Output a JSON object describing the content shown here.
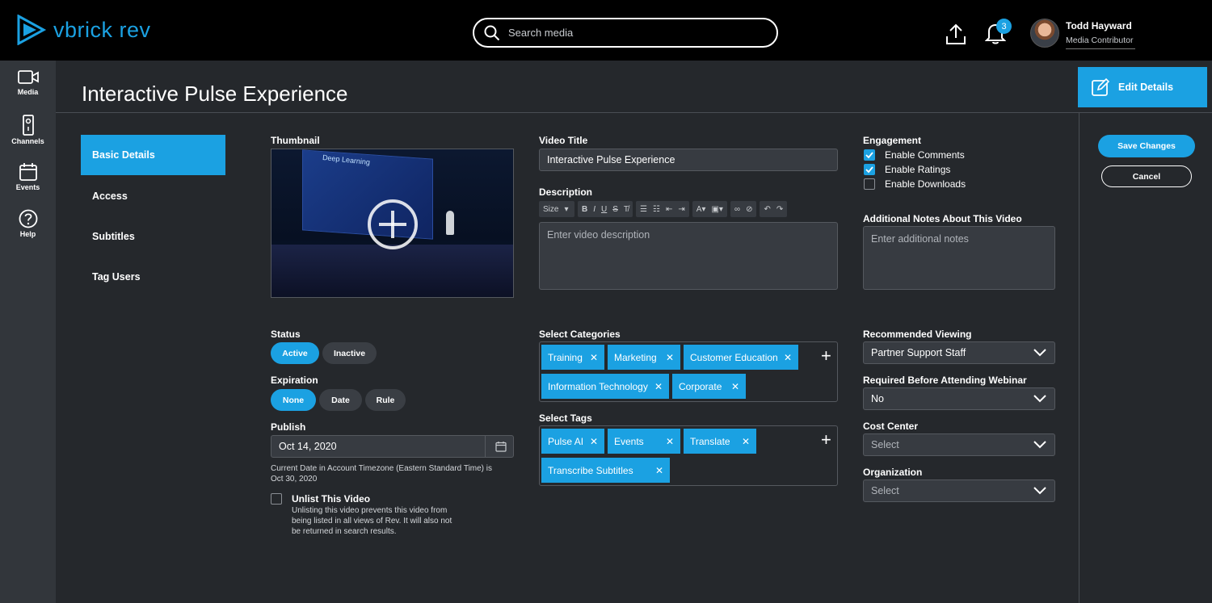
{
  "brand": {
    "name": "vbrick rev",
    "accent": "#1ba1e2"
  },
  "search": {
    "placeholder": "Search media",
    "icon": "search-icon"
  },
  "header": {
    "notification_count": "3",
    "user_name": "Todd Hayward",
    "user_role": "Media Contributor"
  },
  "nav": [
    {
      "label": "Media",
      "icon": "video-camera-icon"
    },
    {
      "label": "Channels",
      "icon": "remote-icon"
    },
    {
      "label": "Events",
      "icon": "calendar-icon"
    },
    {
      "label": "Help",
      "icon": "help-icon"
    }
  ],
  "page": {
    "title": "Interactive Pulse Experience",
    "edit_button": "Edit Details"
  },
  "side_tabs": [
    "Basic Details",
    "Access",
    "Subtitles",
    "Tag Users"
  ],
  "thumbnail": {
    "label": "Thumbnail",
    "slide_text": "Deep Learning"
  },
  "video_title": {
    "label": "Video Title",
    "value": "Interactive Pulse Experience"
  },
  "description": {
    "label": "Description",
    "placeholder": "Enter video description",
    "size_label": "Size"
  },
  "engagement": {
    "label": "Engagement",
    "options": [
      {
        "label": "Enable Comments",
        "checked": true
      },
      {
        "label": "Enable Ratings",
        "checked": true
      },
      {
        "label": "Enable Downloads",
        "checked": false
      }
    ]
  },
  "notes": {
    "label": "Additional Notes About This Video",
    "placeholder": "Enter additional notes"
  },
  "actions": {
    "save": "Save Changes",
    "cancel": "Cancel"
  },
  "status": {
    "label": "Status",
    "options": [
      "Active",
      "Inactive"
    ],
    "selected": "Active"
  },
  "expiration": {
    "label": "Expiration",
    "options": [
      "None",
      "Date",
      "Rule"
    ],
    "selected": "None"
  },
  "publish": {
    "label": "Publish",
    "value": "Oct 14, 2020",
    "note_line1": "Current Date in Account Timezone (Eastern Standard Time) is",
    "note_line2": "Oct 30, 2020"
  },
  "unlist": {
    "label": "Unlist This Video",
    "desc_line1": "Unlisting this video prevents this video from",
    "desc_line2": "being listed in all views of Rev. It will also not",
    "desc_line3": "be returned in search results."
  },
  "categories": {
    "label": "Select Categories",
    "items": [
      "Training",
      "Marketing",
      "Customer Education",
      "Information Technology",
      "Corporate"
    ]
  },
  "tags": {
    "label": "Select Tags",
    "items": [
      "Pulse AI",
      "Events",
      "Translate",
      "Transcribe Subtitles"
    ]
  },
  "recommended": {
    "label": "Recommended Viewing",
    "value": "Partner Support Staff"
  },
  "required_webinar": {
    "label": "Required Before Attending Webinar",
    "value": "No"
  },
  "cost_center": {
    "label": "Cost Center",
    "value": "Select"
  },
  "organization": {
    "label": "Organization",
    "value": "Select"
  }
}
